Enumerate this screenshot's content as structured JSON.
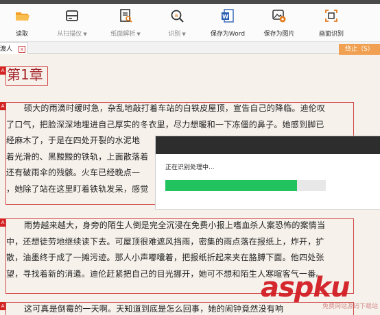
{
  "toolbar": {
    "items": [
      {
        "label": "读取",
        "icon": "folder-open-icon"
      },
      {
        "label": "从扫描仪",
        "icon": "scanner-icon"
      },
      {
        "label": "纸面解析",
        "icon": "document-analysis-icon"
      },
      {
        "label": "识别",
        "icon": "magnifier-recognize-icon"
      },
      {
        "label": "保存为Word",
        "icon": "word-icon"
      },
      {
        "label": "保存为图片",
        "icon": "save-image-icon"
      },
      {
        "label": "画面识别",
        "icon": "screen-capture-icon"
      }
    ]
  },
  "tab": {
    "label": "渡人",
    "close": "x"
  },
  "document": {
    "mark": "A",
    "chapter": "第1章",
    "paragraph1": [
      "硕大的雨滴时缓时急，杂乱地敲打着车站的白铁皮屋顶，宣告自己的降临。迪伦叹",
      "了口气，把脸深深地埋进自己厚实的冬衣里，尽力想暖和一下冻僵的鼻子。她感到脚已",
      "经麻木了，于是在四处开裂的水泥地",
      "着光滑的、黑黢黢的铁轨，上面散落着",
      "还有破雨伞的残骸。火车已经晚点一",
      "，她除了站在这里盯着铁轨发呆，感觉"
    ],
    "paragraph2": [
      "雨势越来越大，身旁的陌生人倒是完全沉浸在免费小报上嗜血杀人案恐怖的案情当",
      "中，还想徒劳地继续读下去。可屋顶很难遮风挡雨，密集的雨点落在报纸上，炸开，扩",
      "散，油墨终于成了一摊污迹。那人小声嘟囔着，把报纸折起来夹在胳膊下面。他四处张",
      "望，寻找着新的消遣。迪伦赶紧把自己的目光挪开，她可不想和陌生人寒暄客气一番。"
    ],
    "paragraph3": [
      "这可真是倒霉的一天啊。天知道到底是怎么回事，她的闹钟竟然没有响"
    ]
  },
  "dialog": {
    "message": "正在识别处理中...",
    "progress": 0.82,
    "stop_label": "终止（S）"
  },
  "watermark": {
    "main": "aspku",
    "sub": "免费网站源码下载站"
  },
  "colors": {
    "accent": "#d32323",
    "progress": "#22c25e",
    "stop": "#f0a050"
  }
}
